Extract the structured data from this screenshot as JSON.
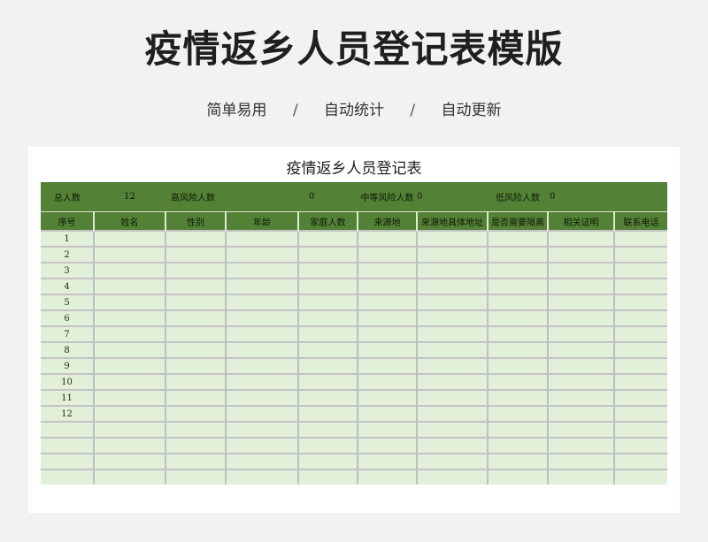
{
  "page": {
    "title": "疫情返乡人员登记表模版",
    "features": [
      "简单易用",
      "自动统计",
      "自动更新"
    ],
    "separator": "/"
  },
  "sheet": {
    "title": "疫情返乡人员登记表",
    "summary": {
      "total_label": "总人数",
      "total_value": "12",
      "high_label": "高风险人数",
      "high_value": "0",
      "mid_label": "中等风险人数",
      "mid_value": "0",
      "low_label": "低风险人数",
      "low_value": "0"
    },
    "columns": [
      "序号",
      "姓名",
      "性别",
      "年龄",
      "家庭人数",
      "来源地",
      "来源地具体地址",
      "是否需要隔离",
      "相关证明",
      "联系电话"
    ],
    "rows": [
      "1",
      "2",
      "3",
      "4",
      "5",
      "6",
      "7",
      "8",
      "9",
      "10",
      "11",
      "12",
      "",
      "",
      "",
      ""
    ]
  },
  "colors": {
    "header_green": "#538135",
    "row_green": "#e2efd9"
  }
}
